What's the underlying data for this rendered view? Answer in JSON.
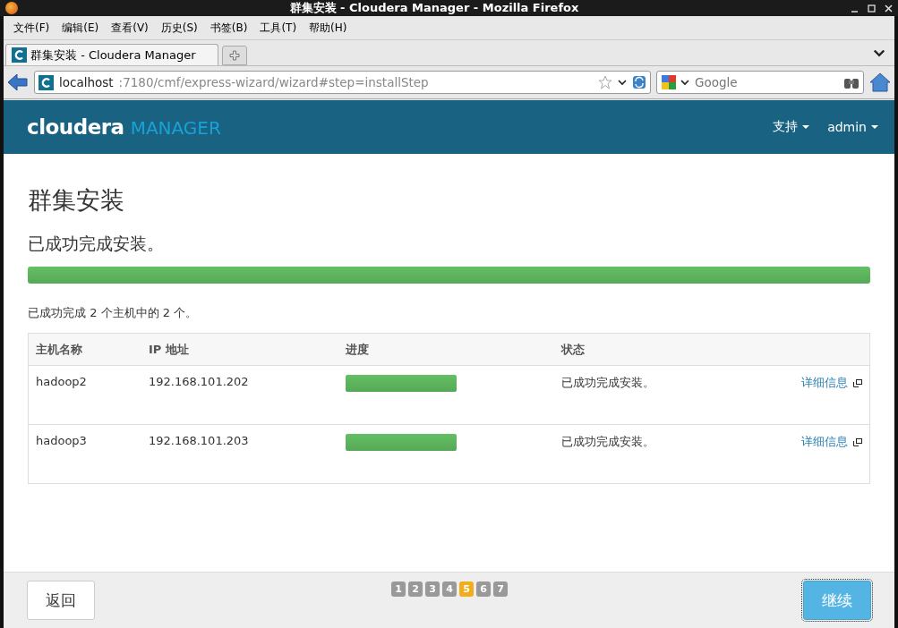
{
  "window": {
    "title": "群集安装 - Cloudera Manager - Mozilla Firefox"
  },
  "menu": [
    "文件(F)",
    "编辑(E)",
    "查看(V)",
    "历史(S)",
    "书签(B)",
    "工具(T)",
    "帮助(H)"
  ],
  "tabs": [
    {
      "label": "群集安装 - Cloudera Manager",
      "selected": true
    }
  ],
  "address": {
    "host": "localhost",
    "path": ":7180/cmf/express-wizard/wizard#step=installStep"
  },
  "search": {
    "placeholder": "Google"
  },
  "header": {
    "logo_main": "cloudera",
    "logo_sub": "MANAGER",
    "nav": [
      "支持",
      "admin"
    ]
  },
  "page": {
    "title": "群集安装",
    "status": "已成功完成安装。",
    "level": 1,
    "summary": "已成功完成 2 个主机中的 2 个。"
  },
  "table": {
    "columns": [
      "主机名称",
      "IP 地址",
      "进度",
      "状态"
    ],
    "rows": [
      {
        "host": "hadoop2",
        "ip": "192.168.101.202",
        "level": 1,
        "status": "已成功完成安装。",
        "link": "详细信息"
      },
      {
        "host": "hadoop3",
        "ip": "192.168.101.203",
        "level": 1,
        "status": "已成功完成安装。",
        "link": "详细信息"
      }
    ]
  },
  "footer": {
    "back": "返回",
    "continue": "继续",
    "steps": [
      {
        "label": "1",
        "selected": false
      },
      {
        "label": "2",
        "selected": false
      },
      {
        "label": "3",
        "selected": false
      },
      {
        "label": "4",
        "selected": false
      },
      {
        "label": "5",
        "selected": true
      },
      {
        "label": "6",
        "selected": false
      },
      {
        "label": "7",
        "selected": false
      }
    ]
  }
}
